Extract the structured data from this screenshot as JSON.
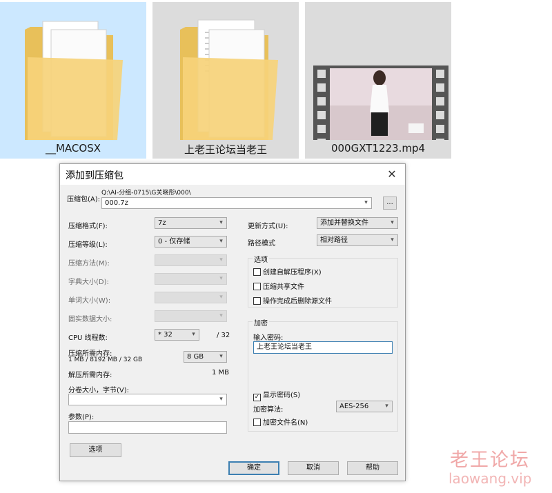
{
  "explorer": {
    "items": [
      {
        "label": "__MACOSX",
        "icon": "folder-icon",
        "selected": true
      },
      {
        "label": "上老王论坛当老王",
        "icon": "folder-icon",
        "selected": false
      },
      {
        "label": "000GXT1223.mp4",
        "icon": "video-file-icon",
        "selected": false
      }
    ]
  },
  "dialog": {
    "title": "添加到压缩包",
    "close": "✕",
    "archive": {
      "label": "压缩包(A):",
      "path": "Q:\\AI-分组-0715\\G关晓彤\\000\\",
      "name": "000.7z",
      "browse": "..."
    },
    "left": {
      "format_label": "压缩格式(F):",
      "format_value": "7z",
      "level_label": "压缩等级(L):",
      "level_value": "0 - 仅存储",
      "method_label": "压缩方法(M):",
      "dict_label": "字典大小(D):",
      "word_label": "单词大小(W):",
      "solid_label": "固实数据大小:",
      "cpu_label": "CPU 线程数:",
      "cpu_value": "* 32",
      "cpu_max": "/ 32",
      "mem_comp_label": "压缩所需内存:",
      "mem_comp_detail": "1 MB / 8192 MB / 32 GB",
      "mem_comp_value": "8 GB",
      "mem_decomp_label": "解压所需内存:",
      "mem_decomp_value": "1 MB",
      "split_label": "分卷大小，字节(V):",
      "split_value": "",
      "params_label": "参数(P):",
      "params_value": "",
      "options_button": "选项"
    },
    "right": {
      "update_label": "更新方式(U):",
      "update_value": "添加并替换文件",
      "path_label": "路径模式",
      "path_value": "相对路径",
      "options_group": "选项",
      "opt_sfx": "创建自解压程序(X)",
      "opt_shared": "压缩共享文件",
      "opt_delete": "操作完成后删除源文件",
      "encrypt_group": "加密",
      "password_label": "输入密码:",
      "password_value": "上老王论坛当老王",
      "show_password": "显示密码(S)",
      "algo_label": "加密算法:",
      "algo_value": "AES-256",
      "encrypt_names": "加密文件名(N)"
    },
    "buttons": {
      "ok": "确定",
      "cancel": "取消",
      "help": "帮助"
    }
  },
  "watermark": {
    "line1": "老王论坛",
    "line2": "laowang.vip"
  }
}
